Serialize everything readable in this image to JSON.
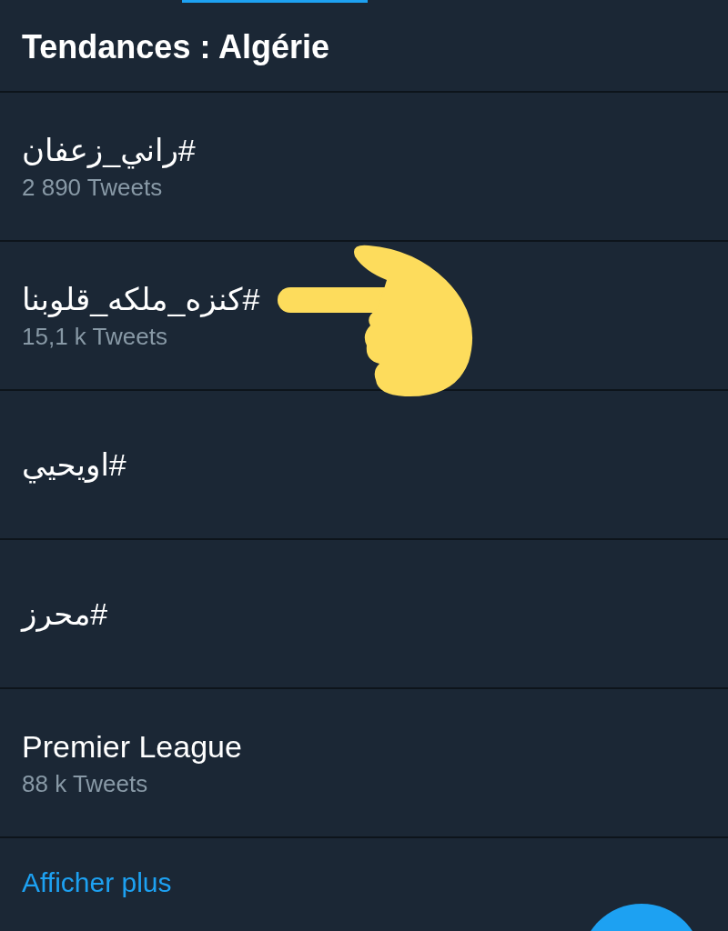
{
  "header": {
    "title": "Tendances : Algérie"
  },
  "trends": [
    {
      "name": "#راني_زعفان",
      "count": "2 890 Tweets"
    },
    {
      "name": "#كنزه_ملكه_قلوبنا",
      "count": "15,1 k Tweets"
    },
    {
      "name": "#اويحيي"
    },
    {
      "name": "#محرز"
    },
    {
      "name": "Premier League",
      "count": "88 k Tweets"
    }
  ],
  "show_more": "Afficher plus"
}
